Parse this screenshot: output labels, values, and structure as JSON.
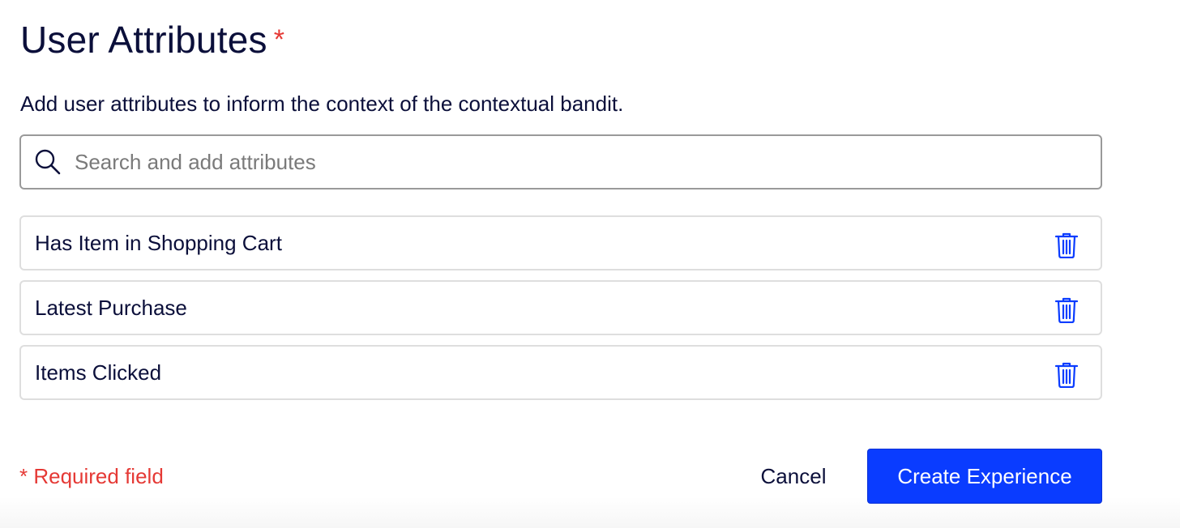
{
  "section": {
    "title": "User Attributes",
    "required_marker": "*",
    "description": "Add user attributes to inform the context of the contextual bandit."
  },
  "search": {
    "value": "",
    "placeholder": "Search and add attributes",
    "icon": "search-icon"
  },
  "attributes": [
    {
      "label": "Has Item in Shopping Cart",
      "icon": "trash-icon"
    },
    {
      "label": "Latest Purchase",
      "icon": "trash-icon"
    },
    {
      "label": "Items Clicked",
      "icon": "trash-icon"
    }
  ],
  "footer": {
    "required_note": "* Required field",
    "cancel_label": "Cancel",
    "create_label": "Create Experience"
  },
  "colors": {
    "text": "#0b0f3a",
    "required": "#e53935",
    "accent": "#0a3cff",
    "border_input": "#9a9a9a",
    "border_item": "#dedede"
  }
}
